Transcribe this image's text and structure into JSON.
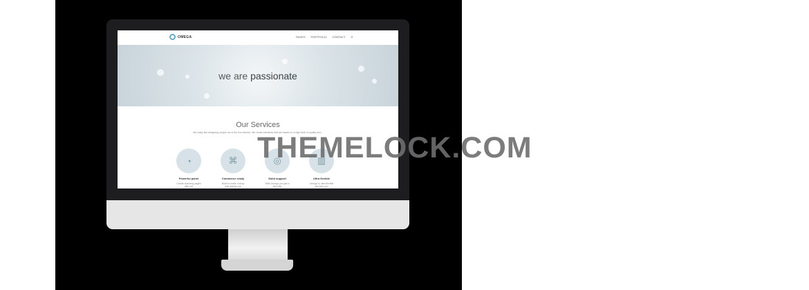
{
  "nav": {
    "logo_text": "OMEGA",
    "items": [
      "PAGES",
      "PORTFOLIO",
      "CONTACT"
    ],
    "search_icon": "search-icon"
  },
  "hero": {
    "lead": "we are",
    "emphasis": "passionate"
  },
  "services": {
    "title": "Our Services",
    "description": "We really like designing unique out of the box themes. We create elements that are based on a high level of quality and...",
    "items": [
      {
        "icon": "dashboard-icon",
        "title": "Powerful panel",
        "text": "Create stunning pages with our"
      },
      {
        "icon": "gift-icon",
        "title": "Commerce ready",
        "text": "Build to make a shop that stands out"
      },
      {
        "icon": "support-icon",
        "title": "Solid support",
        "text": "With Omega you get a five star"
      },
      {
        "icon": "map-icon",
        "title": "Ultra flexible",
        "text": "Omega is ultra flexible and lets you"
      }
    ]
  },
  "watermark": "THEMELOCK.COM"
}
